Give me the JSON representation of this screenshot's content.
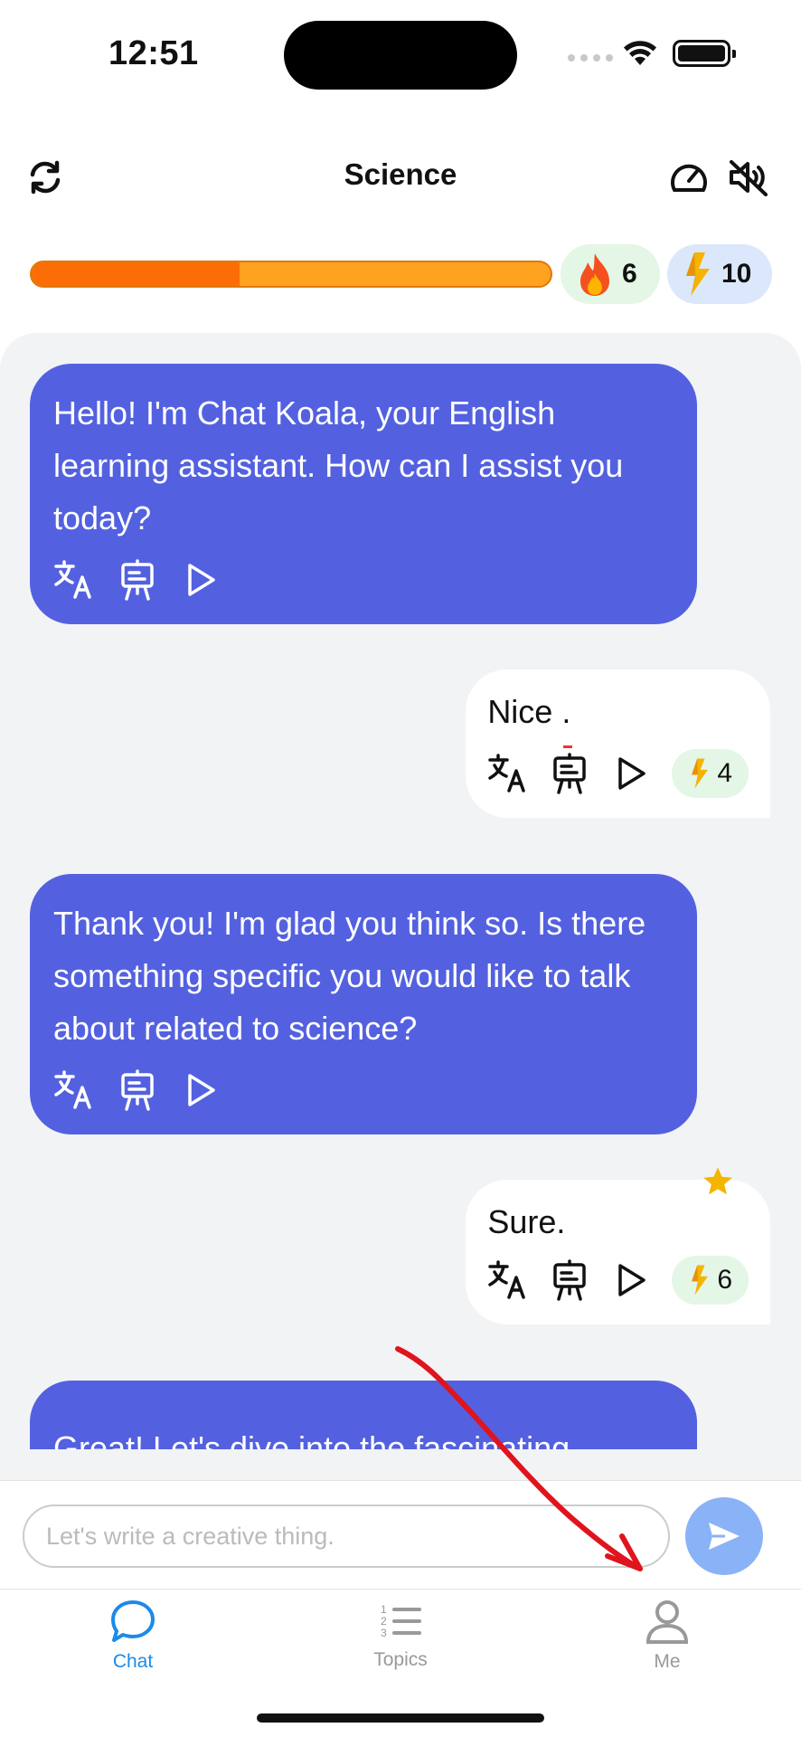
{
  "status_bar": {
    "time": "12:51"
  },
  "header": {
    "title": "Science"
  },
  "stats": {
    "progress_fraction": 0.4,
    "streak": "6",
    "energy": "10"
  },
  "messages": [
    {
      "role": "bot",
      "text": "Hello! I'm Chat Koala, your English learning assistant. How can I assist you today?"
    },
    {
      "role": "user",
      "text": "Nice .",
      "score": "4"
    },
    {
      "role": "bot",
      "text": "Thank you! I'm glad you think so. Is there something specific you would like to talk about related to science?"
    },
    {
      "role": "user",
      "text": "Sure.",
      "score": "6",
      "starred": true
    },
    {
      "role": "bot",
      "text": "Great! Let's dive into the fascinating"
    }
  ],
  "input": {
    "placeholder": "Let's write a creative thing."
  },
  "tabs": [
    {
      "label": "Chat",
      "icon": "chat-bubble-icon",
      "active": true
    },
    {
      "label": "Topics",
      "icon": "list-icon",
      "active": false
    },
    {
      "label": "Me",
      "icon": "person-icon",
      "active": false
    }
  ],
  "colors": {
    "bot_bubble": "#5361E0",
    "accent": "#1b8be8",
    "progress": "#FB6E07",
    "progress_track": "#FFA220",
    "send_button": "#8ab2f6"
  }
}
